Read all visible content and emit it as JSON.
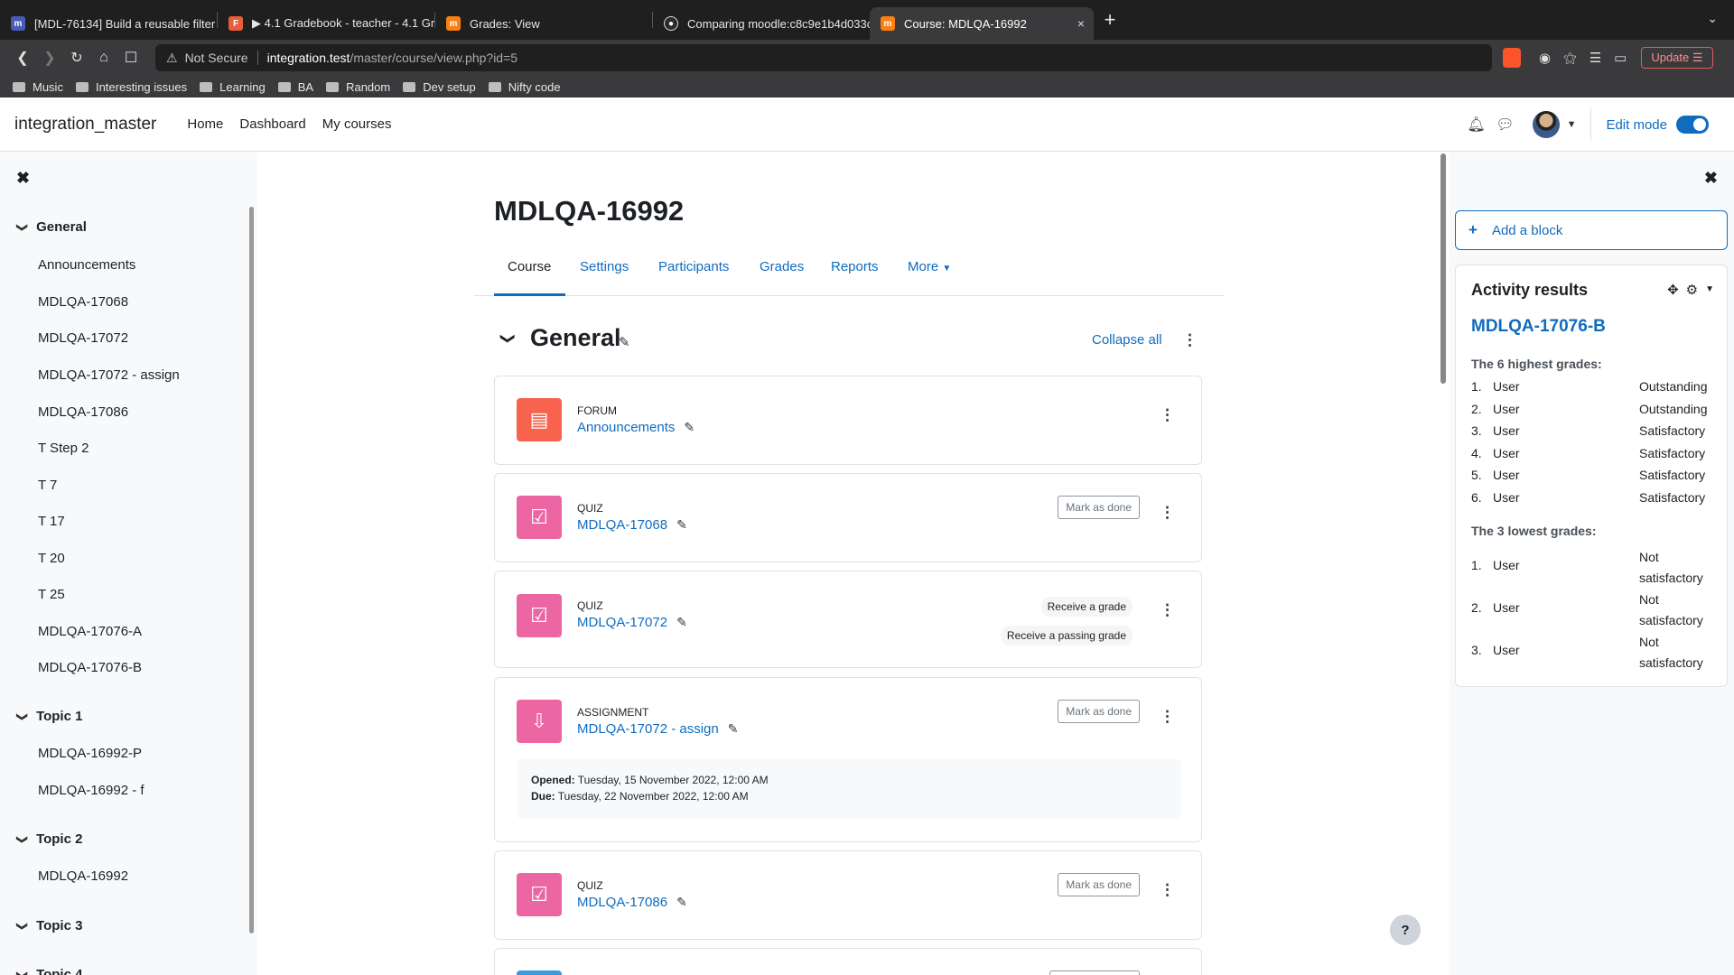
{
  "browser": {
    "tabs": [
      {
        "title": "[MDL-76134] Build a reusable filter",
        "fav_color": "#4a5ab8",
        "fav_text": "m"
      },
      {
        "title": "▶ 4.1 Gradebook - teacher - 4.1 Gra",
        "fav_color": "#e85d3b",
        "fav_text": "F"
      },
      {
        "title": "Grades: View",
        "fav_color": "#f98012",
        "fav_text": "m"
      },
      {
        "title": "Comparing moodle:c8c9e1b4d033c",
        "fav_color": "#2b2b2b",
        "fav_text": "●"
      },
      {
        "title": "Course: MDLQA-16992",
        "fav_color": "#f98012",
        "fav_text": "m"
      }
    ],
    "close_icon": "×",
    "new_tab": "+",
    "url": {
      "warning": "Not Secure",
      "host": "integration.test",
      "path": "/master/course/view.php?id=5"
    },
    "update_label": "Update",
    "bookmarks": [
      "Music",
      "Interesting issues",
      "Learning",
      "BA",
      "Random",
      "Dev setup",
      "Nifty code"
    ]
  },
  "navbar": {
    "brand": "integration_master",
    "links": [
      "Home",
      "Dashboard",
      "My courses"
    ],
    "edit_mode": "Edit mode"
  },
  "course_index": {
    "sections": [
      {
        "title": "General",
        "items": [
          "Announcements",
          "MDLQA-17068",
          "MDLQA-17072",
          "MDLQA-17072 - assign",
          "MDLQA-17086",
          "T Step 2",
          "T 7",
          "T 17",
          "T 20",
          "T 25",
          "MDLQA-17076-A",
          "MDLQA-17076-B"
        ]
      },
      {
        "title": "Topic 1",
        "items": [
          "MDLQA-16992-P",
          "MDLQA-16992 - f"
        ]
      },
      {
        "title": "Topic 2",
        "items": [
          "MDLQA-16992"
        ]
      },
      {
        "title": "Topic 3",
        "items": []
      },
      {
        "title": "Topic 4",
        "items": []
      }
    ]
  },
  "page": {
    "title": "MDLQA-16992",
    "tabs": [
      "Course",
      "Settings",
      "Participants",
      "Grades",
      "Reports",
      "More"
    ],
    "section_title": "General",
    "collapse_all": "Collapse all"
  },
  "activities": [
    {
      "type": "FORUM",
      "name": "Announcements",
      "color": "#f7634d",
      "icon": "forum-icon"
    },
    {
      "type": "QUIZ",
      "name": "MDLQA-17068",
      "color": "#eb66a2",
      "icon": "quiz-icon",
      "mark_done": "Mark as done"
    },
    {
      "type": "QUIZ",
      "name": "MDLQA-17072",
      "color": "#eb66a2",
      "icon": "quiz-icon",
      "pills": [
        "Receive a grade",
        "Receive a passing grade"
      ]
    },
    {
      "type": "ASSIGNMENT",
      "name": "MDLQA-17072 - assign",
      "color": "#eb66a2",
      "icon": "assignment-icon",
      "mark_done": "Mark as done",
      "opened_label": "Opened:",
      "opened": "Tuesday, 15 November 2022, 12:00 AM",
      "due_label": "Due:",
      "due": "Tuesday, 22 November 2022, 12:00 AM"
    },
    {
      "type": "QUIZ",
      "name": "MDLQA-17086",
      "color": "#eb66a2",
      "icon": "quiz-icon",
      "mark_done": "Mark as done"
    }
  ],
  "right_drawer": {
    "add_block": "Add a block",
    "block_title": "Activity results",
    "activity_link": "MDLQA-17076-B",
    "highest_label": "The 6 highest grades:",
    "highest": [
      {
        "n": "1.",
        "user": "User",
        "grade": "Outstanding"
      },
      {
        "n": "2.",
        "user": "User",
        "grade": "Outstanding"
      },
      {
        "n": "3.",
        "user": "User",
        "grade": "Satisfactory"
      },
      {
        "n": "4.",
        "user": "User",
        "grade": "Satisfactory"
      },
      {
        "n": "5.",
        "user": "User",
        "grade": "Satisfactory"
      },
      {
        "n": "6.",
        "user": "User",
        "grade": "Satisfactory"
      }
    ],
    "lowest_label": "The 3 lowest grades:",
    "lowest": [
      {
        "n": "1.",
        "user": "User",
        "grade1": "Not",
        "grade2": "satisfactory"
      },
      {
        "n": "2.",
        "user": "User",
        "grade1": "Not",
        "grade2": "satisfactory"
      },
      {
        "n": "3.",
        "user": "User",
        "grade1": "Not",
        "grade2": "satisfactory"
      }
    ]
  },
  "help": "?"
}
